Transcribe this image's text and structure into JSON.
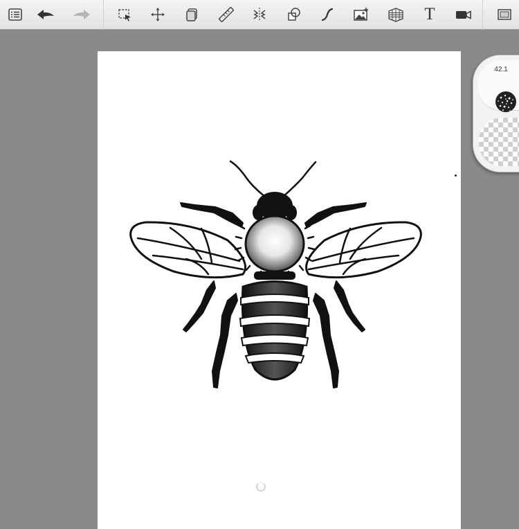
{
  "toolbar": {
    "items": [
      {
        "name": "layers-list-button",
        "icon": "list-icon"
      },
      {
        "name": "undo-button",
        "icon": "undo-arrow-icon"
      },
      {
        "name": "redo-button",
        "icon": "redo-arrow-icon",
        "disabled": true
      },
      {
        "name": "select-button",
        "icon": "marquee-select-icon"
      },
      {
        "name": "transform-button",
        "icon": "move-arrows-icon"
      },
      {
        "name": "layer-stack-button",
        "icon": "layer-stack-icon"
      },
      {
        "name": "ruler-button",
        "icon": "ruler-icon"
      },
      {
        "name": "symmetry-button",
        "icon": "symmetry-icon"
      },
      {
        "name": "shapes-button",
        "icon": "shapes-icon"
      },
      {
        "name": "curve-button",
        "icon": "french-curve-icon"
      },
      {
        "name": "import-image-button",
        "icon": "image-icon"
      },
      {
        "name": "perspective-button",
        "icon": "perspective-grid-icon"
      },
      {
        "name": "text-button",
        "icon": "text-icon",
        "label": "T"
      },
      {
        "name": "record-button",
        "icon": "video-camera-icon"
      },
      {
        "name": "fullscreen-button",
        "icon": "fullscreen-icon"
      }
    ]
  },
  "brush_panel": {
    "size_value": "42.1",
    "color": "transparent"
  },
  "colors": {
    "toolbar_bg": "#e8e8e8",
    "workspace_bg": "#8a8a8a",
    "canvas_bg": "#ffffff",
    "ink": "#111111"
  }
}
